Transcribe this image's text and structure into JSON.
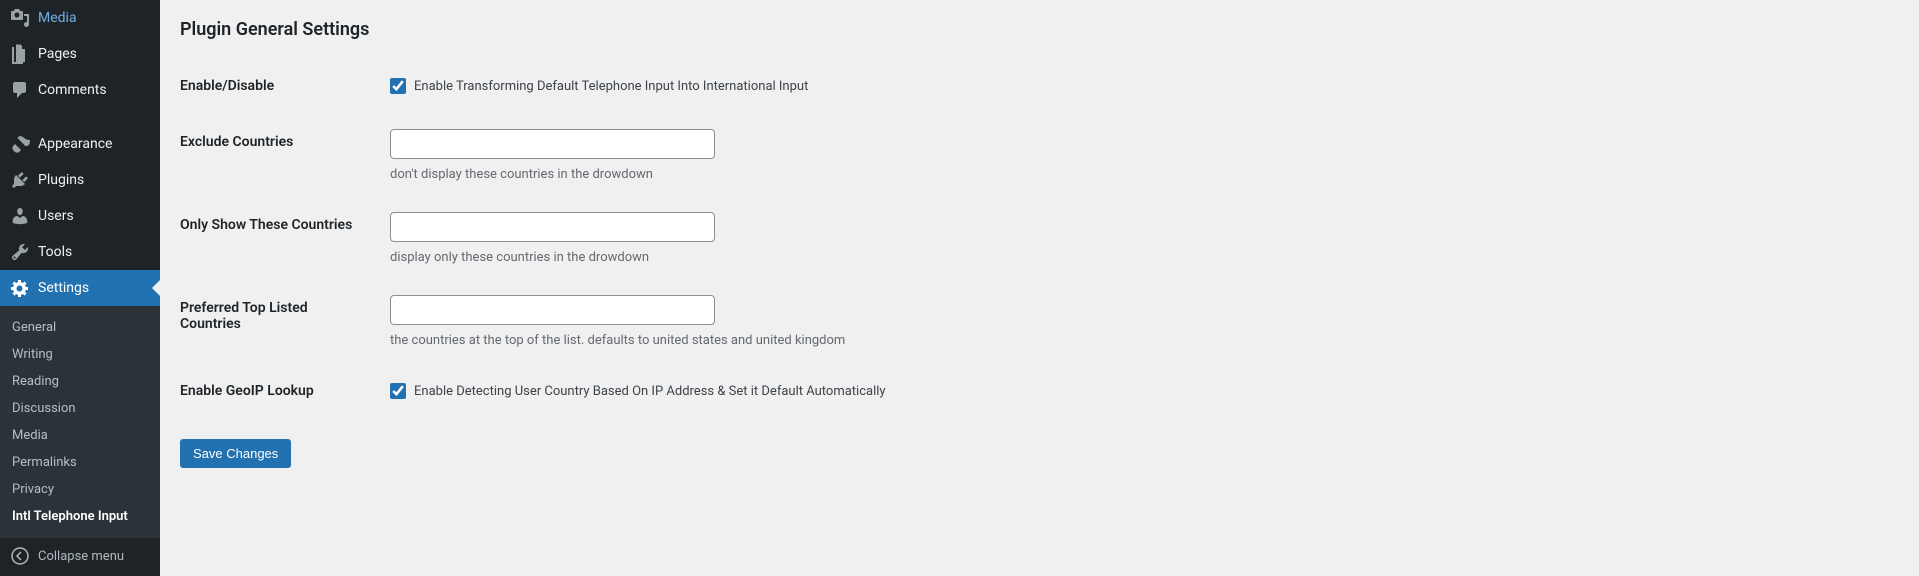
{
  "sidebar": {
    "items": [
      {
        "icon": "media",
        "label": "Media"
      },
      {
        "icon": "page",
        "label": "Pages"
      },
      {
        "icon": "comment",
        "label": "Comments"
      },
      {
        "icon": "appearance",
        "label": "Appearance"
      },
      {
        "icon": "plugin",
        "label": "Plugins"
      },
      {
        "icon": "users",
        "label": "Users"
      },
      {
        "icon": "tools",
        "label": "Tools"
      },
      {
        "icon": "settings",
        "label": "Settings"
      }
    ],
    "submenu": [
      {
        "label": "General"
      },
      {
        "label": "Writing"
      },
      {
        "label": "Reading"
      },
      {
        "label": "Discussion"
      },
      {
        "label": "Media"
      },
      {
        "label": "Permalinks"
      },
      {
        "label": "Privacy"
      },
      {
        "label": "Intl Telephone Input"
      }
    ],
    "collapse": "Collapse menu"
  },
  "page": {
    "title": "Plugin General Settings",
    "fields": {
      "enable": {
        "label": "Enable/Disable",
        "checkbox_label": "Enable Transforming Default Telephone Input Into International Input",
        "checked": true
      },
      "exclude": {
        "label": "Exclude Countries",
        "value": "",
        "desc": "don't display these countries in the drowdown"
      },
      "only": {
        "label": "Only Show These Countries",
        "value": "",
        "desc": "display only these countries in the drowdown"
      },
      "preferred": {
        "label": "Preferred Top Listed Countries",
        "value": "",
        "desc": "the countries at the top of the list. defaults to united states and united kingdom"
      },
      "geoip": {
        "label": "Enable GeoIP Lookup",
        "checkbox_label": "Enable Detecting User Country Based On IP Address & Set it Default Automatically",
        "checked": true
      }
    },
    "save": "Save Changes"
  }
}
